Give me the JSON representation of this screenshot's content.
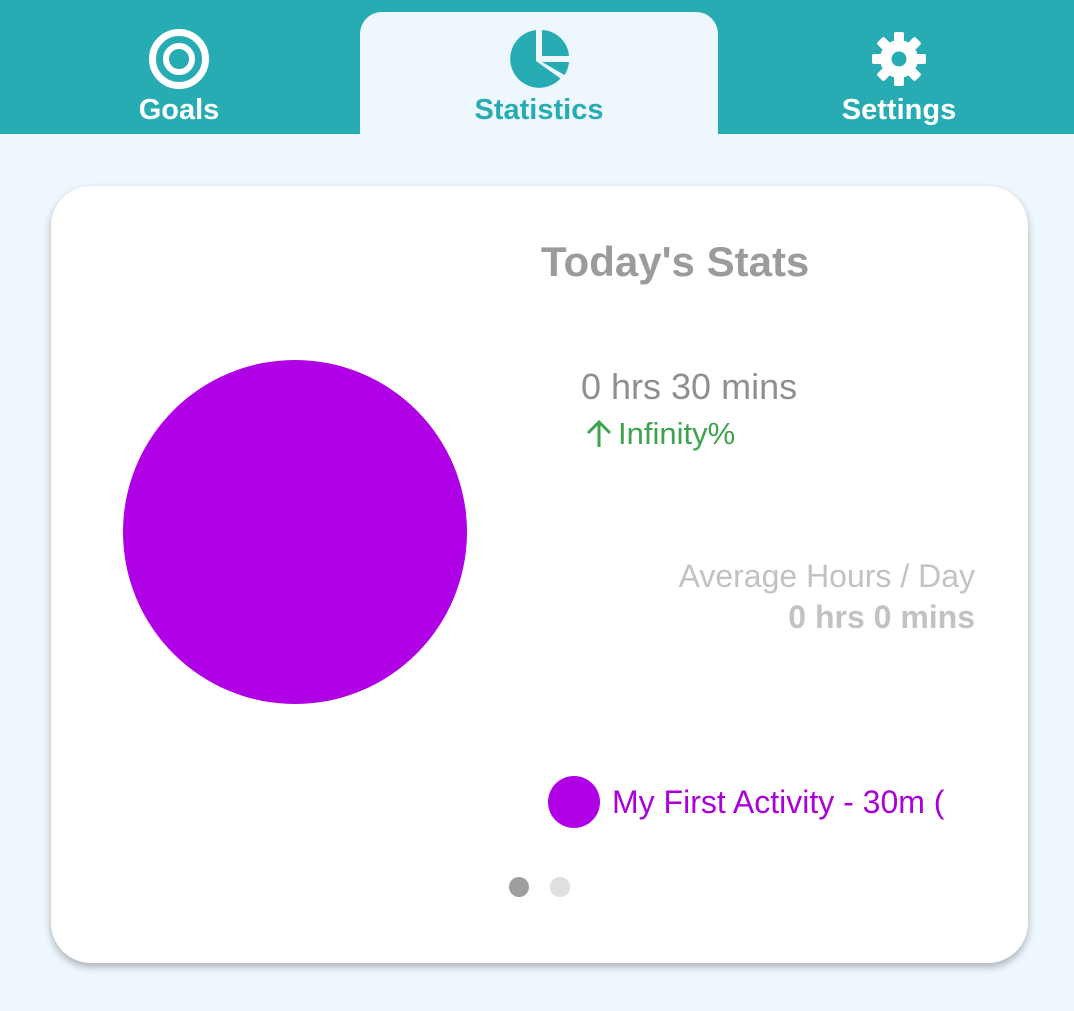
{
  "colors": {
    "header": "#27acb3",
    "page_background": "#eef7fd",
    "activity": "#b000e5",
    "increase": "#3fa34d"
  },
  "tabs": [
    {
      "label": "Goals",
      "icon": "target-icon",
      "active": false
    },
    {
      "label": "Statistics",
      "icon": "pie-chart-icon",
      "active": true
    },
    {
      "label": "Settings",
      "icon": "gear-icon",
      "active": false
    }
  ],
  "stats": {
    "title": "Today's Stats",
    "today_total": "0 hrs 30 mins",
    "change": "Infinity%",
    "change_icon": "arrow-up-icon",
    "average_label": "Average Hours / Day",
    "average_value": "0 hrs 0 mins"
  },
  "chart_data": {
    "type": "pie",
    "slices": [
      {
        "label": "My First Activity",
        "value": 30,
        "color": "#b000e5"
      }
    ]
  },
  "legend": {
    "items": [
      {
        "text": "My First Activity - 30m (",
        "color": "#b000e5"
      }
    ]
  },
  "pager": {
    "pages": 2,
    "current": 1
  }
}
